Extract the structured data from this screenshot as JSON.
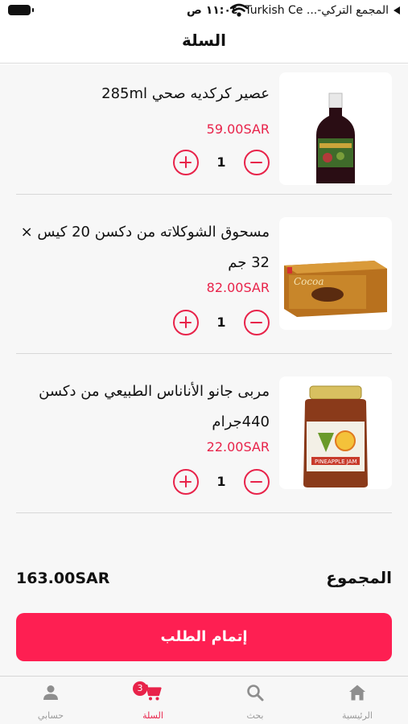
{
  "status_bar": {
    "time": "١١:٠٤ ص",
    "carrier": "المجمع التركي-... Turkish Ce"
  },
  "header": {
    "title": "السلة"
  },
  "cart": {
    "items": [
      {
        "name": "عصير كركديه صحي 285ml",
        "price": "59.00SAR",
        "quantity": "1",
        "image": "hibiscus-juice-bottle"
      },
      {
        "name": "مسحوق الشوكلاته من دكسن 20 كيس × 32 جم",
        "price": "82.00SAR",
        "quantity": "1",
        "image": "chocolate-powder-box"
      },
      {
        "name": "مربى جانو الأناناس الطبيعي من دكسن 440جرام",
        "price": "22.00SAR",
        "quantity": "1",
        "image": "pineapple-jam-jar"
      }
    ],
    "total_label": "المجموع",
    "total_value": "163.00SAR",
    "checkout_label": "إتمام الطلب"
  },
  "tabs": [
    {
      "label": "الرئيسية",
      "icon": "home-icon",
      "active": false
    },
    {
      "label": "بحث",
      "icon": "search-icon",
      "active": false
    },
    {
      "label": "السلة",
      "icon": "cart-icon",
      "active": true,
      "badge": "3"
    },
    {
      "label": "حسابي",
      "icon": "person-icon",
      "active": false
    }
  ],
  "colors": {
    "accent": "#e8234a",
    "button": "#fe1f52",
    "background": "#f7f7f7"
  }
}
